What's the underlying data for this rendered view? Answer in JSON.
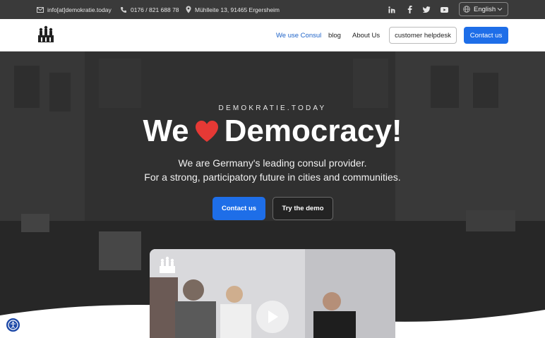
{
  "topbar": {
    "email": "info[at]demokratie.today",
    "phone": "0176 / 821 688 78",
    "address": "Mühlleite 13, 91465 Ergersheim",
    "social": [
      "linkedin-icon",
      "facebook-icon",
      "twitter-icon",
      "youtube-icon"
    ],
    "language": "English"
  },
  "nav": {
    "links": [
      {
        "label": "We use Consul",
        "active": true
      },
      {
        "label": "blog"
      },
      {
        "label": "About Us"
      }
    ],
    "helpdesk": "customer helpdesk",
    "contact": "Contact us"
  },
  "hero": {
    "kicker": "DEMOKRATIE.TODAY",
    "headline_left": "We",
    "headline_right": "Democracy!",
    "line1": "We are Germany's leading consul provider.",
    "line2": "For a strong, participatory future in cities and communities.",
    "cta_primary": "Contact us",
    "cta_secondary": "Try the demo"
  },
  "colors": {
    "accent": "#1e6ee8",
    "heart": "#e53935",
    "topbar": "#3a3a3a"
  }
}
